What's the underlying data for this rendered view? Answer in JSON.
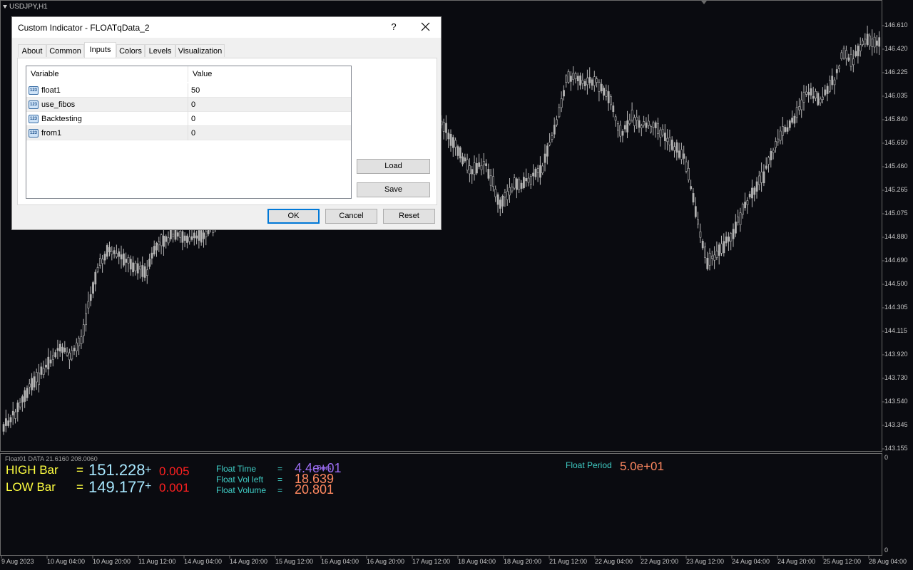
{
  "chart": {
    "symbol": "USDJPY,H1",
    "price_labels": [
      "146.610",
      "146.420",
      "146.225",
      "146.035",
      "145.840",
      "145.650",
      "145.460",
      "145.265",
      "145.075",
      "144.880",
      "144.690",
      "144.500",
      "144.305",
      "144.115",
      "143.920",
      "143.730",
      "143.540",
      "143.345",
      "143.155"
    ],
    "time_labels": [
      "9 Aug 2023",
      "10 Aug 04:00",
      "10 Aug 20:00",
      "11 Aug 12:00",
      "14 Aug 04:00",
      "14 Aug 20:00",
      "15 Aug 12:00",
      "16 Aug 04:00",
      "16 Aug 20:00",
      "17 Aug 12:00",
      "18 Aug 04:00",
      "18 Aug 20:00",
      "21 Aug 12:00",
      "22 Aug 04:00",
      "22 Aug 20:00",
      "23 Aug 12:00",
      "24 Aug 04:00",
      "24 Aug 20:00",
      "25 Aug 12:00",
      "28 Aug 04:00"
    ],
    "colors": {
      "background": "#0a0b10",
      "candle": "#b4b4b4",
      "axis": "#c8c8c8",
      "grid": "#2a2a2a"
    }
  },
  "indicator": {
    "subwindow_title": "Float01 DATA 21.6160 208.0060",
    "scale_top": "0",
    "scale_bottom": "0",
    "high_label": "HIGH Bar",
    "high_eq": "=",
    "high_value": "151.228",
    "high_plus": "+",
    "high_diff": "0.005",
    "low_label": "LOW Bar",
    "low_eq": "=",
    "low_value": "149.177",
    "low_plus": "+",
    "low_diff": "0.001",
    "float_time_label": "Float Time",
    "float_time_eq": "=",
    "float_time_value": "4.4e+01",
    "float_time_overlay": "Bars",
    "float_vol_label": "Float Vol left",
    "float_vol_eq": "=",
    "float_vol_value": "18.639",
    "float_volume_label": "Float Volume",
    "float_volume_eq": "=",
    "float_volume_value": "20.801",
    "float_period_label": "Float Period",
    "float_period_value": "5.0e+01",
    "colors": {
      "yellow": "#ffff40",
      "cyan": "#a8e8ff",
      "red": "#ff2020",
      "teal": "#40d0c8",
      "purple": "#9a6cf0",
      "salmon": "#ff8860"
    }
  },
  "dialog": {
    "title": "Custom Indicator - FLOATqData_2",
    "help": "?",
    "tabs": [
      "About",
      "Common",
      "Inputs",
      "Colors",
      "Levels",
      "Visualization"
    ],
    "active_tab": "Inputs",
    "columns": [
      "Variable",
      "Value"
    ],
    "rows": [
      {
        "icon": "123",
        "variable": "float1",
        "value": "50"
      },
      {
        "icon": "123",
        "variable": "use_fibos",
        "value": "0"
      },
      {
        "icon": "123",
        "variable": "Backtesting",
        "value": "0"
      },
      {
        "icon": "123",
        "variable": "from1",
        "value": "0"
      }
    ],
    "load_label": "Load",
    "save_label": "Save",
    "ok_label": "OK",
    "cancel_label": "Cancel",
    "reset_label": "Reset"
  }
}
